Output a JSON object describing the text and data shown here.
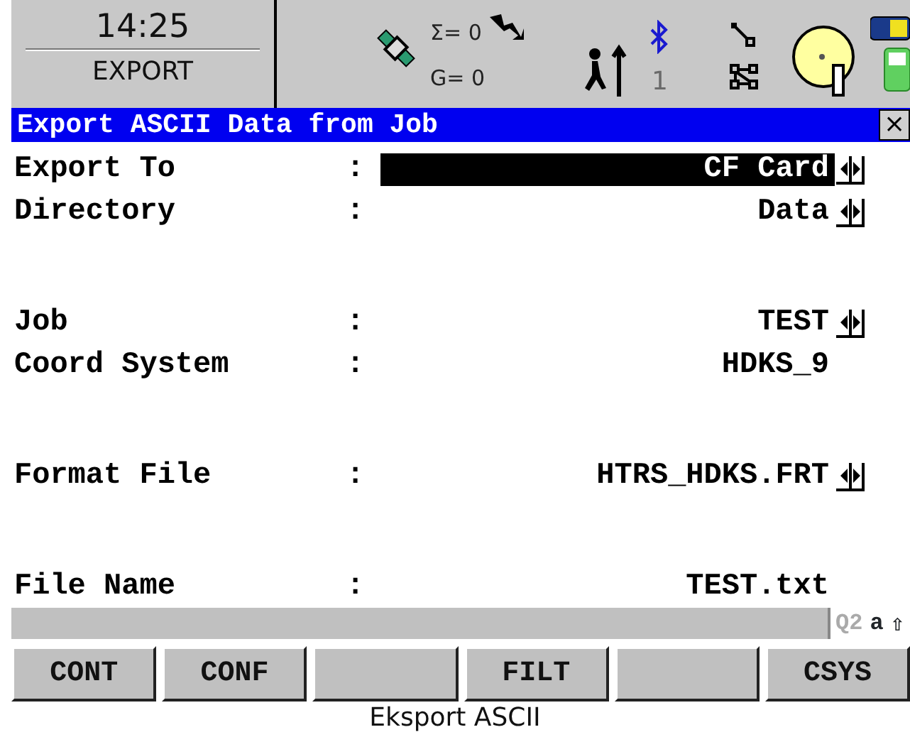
{
  "header": {
    "time": "14:25",
    "panel": "EXPORT",
    "sat_sum": "Σ= 0",
    "sat_g": "G= 0",
    "line_number": "1"
  },
  "dialog": {
    "title": "Export ASCII Data from Job",
    "close": "×"
  },
  "groups": [
    [
      {
        "label": "Export To",
        "sep": ":",
        "value": "CF Card",
        "selector": true,
        "selected": true
      },
      {
        "label": "Directory",
        "sep": ":",
        "value": "Data",
        "selector": true,
        "selected": false
      }
    ],
    [
      {
        "label": "Job",
        "sep": ":",
        "value": "TEST",
        "selector": true,
        "selected": false
      },
      {
        "label": "Coord System",
        "sep": ":",
        "value": "HDKS_9",
        "selector": false,
        "selected": false
      }
    ],
    [
      {
        "label": "Format File",
        "sep": ":",
        "value": "HTRS_HDKS.FRT",
        "selector": true,
        "selected": false
      }
    ],
    [
      {
        "label": "File Name",
        "sep": ":",
        "value": "TEST.txt",
        "selector": false,
        "selected": false
      }
    ]
  ],
  "status": {
    "quality": "Q2",
    "input_mode": "a",
    "shift": "⇧"
  },
  "softkeys": [
    {
      "kind": "key",
      "label": "CONT"
    },
    {
      "kind": "key",
      "label": "CONF"
    },
    {
      "kind": "blank"
    },
    {
      "kind": "key",
      "label": "FILT"
    },
    {
      "kind": "blank"
    },
    {
      "kind": "key",
      "label": "CSYS"
    }
  ],
  "caption": "Eksport ASCII"
}
